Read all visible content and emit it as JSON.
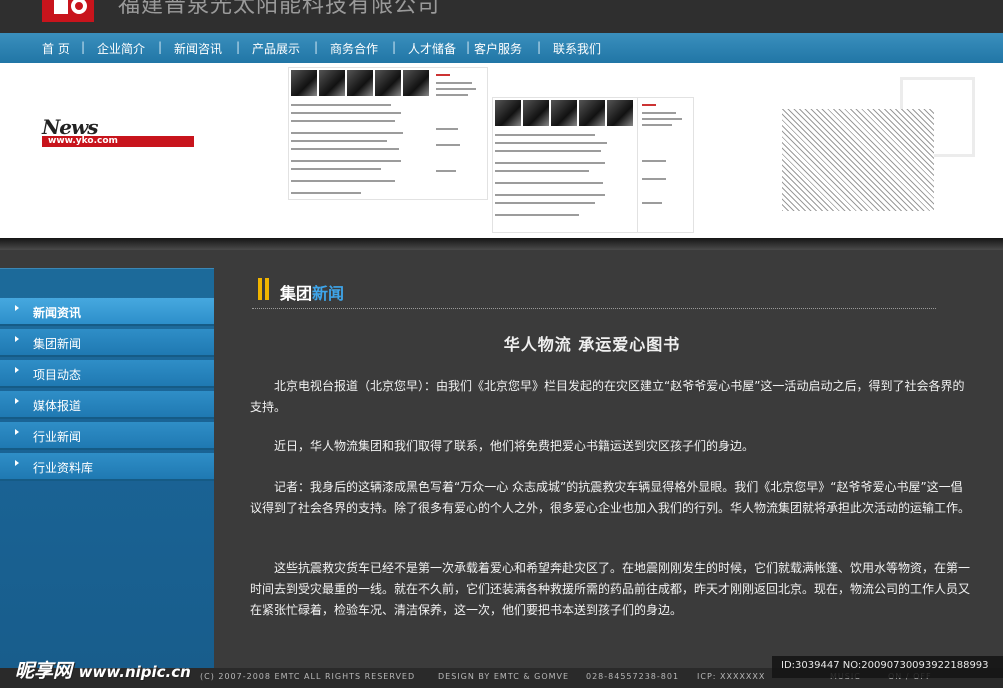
{
  "header": {
    "company_name": "福建晋泉光太阳能科技有限公司"
  },
  "nav": {
    "items": [
      "首 页",
      "企业简介",
      "新闻咨讯",
      "产品展示",
      "商务合作",
      "人才储备",
      "客户服务",
      "联系我们"
    ],
    "separator": "|"
  },
  "banner": {
    "news_word": "News",
    "news_url": "www.yko.com"
  },
  "sidebar": {
    "items": [
      {
        "label": "新闻资讯",
        "active": true
      },
      {
        "label": "集团新闻",
        "active": false
      },
      {
        "label": "项目动态",
        "active": false
      },
      {
        "label": "媒体报道",
        "active": false
      },
      {
        "label": "行业新闻",
        "active": false
      },
      {
        "label": "行业资料库",
        "active": false
      }
    ]
  },
  "content": {
    "section_title_a": "集团",
    "section_title_b": "新闻",
    "article_title": "华人物流  承运爱心图书",
    "paragraphs": [
      "北京电视台报道（北京您早）：由我们《北京您早》栏目发起的在灾区建立“赵爷爷爱心书屋”这一活动启动之后，得到了社会各界的支持。",
      "近日，华人物流集团和我们取得了联系，他们将免费把爱心书籍运送到灾区孩子们的身边。",
      "记者：我身后的这辆漆成黑色写着“万众一心 众志成城”的抗震救灾车辆显得格外显眼。我们《北京您早》“赵爷爷爱心书屋”这一倡议得到了社会各界的支持。除了很多有爱心的个人之外，很多爱心企业也加入我们的行列。华人物流集团就将承担此次活动的运输工作。",
      "这些抗震救灾货车已经不是第一次承载着爱心和希望奔赴灾区了。在地震刚刚发生的时候，它们就载满帐篷、饮用水等物资，在第一时间去到受灾最重的一线。就在不久前，它们还装满各种救援所需的药品前往成都，昨天才刚刚返回北京。现在，物流公司的工作人员又在紧张忙碌着，检验车况、清洁保养，这一次，他们要把书本送到孩子们的身边。"
    ]
  },
  "footer": {
    "copyright": "(C) 2007-2008 EMTC ALL RIGHTS RESERVED",
    "design": "DESIGN BY EMTC & GOMVE",
    "phone": "028-84557238-801",
    "icp": "ICP: XXXXXXX",
    "music": "MUSIC",
    "onoff": "ON / OFF"
  },
  "watermark": {
    "site_name": "昵享网",
    "site_url": "www.nipic.cn",
    "image_id": "ID:3039447 NO:20090730093922188993"
  }
}
